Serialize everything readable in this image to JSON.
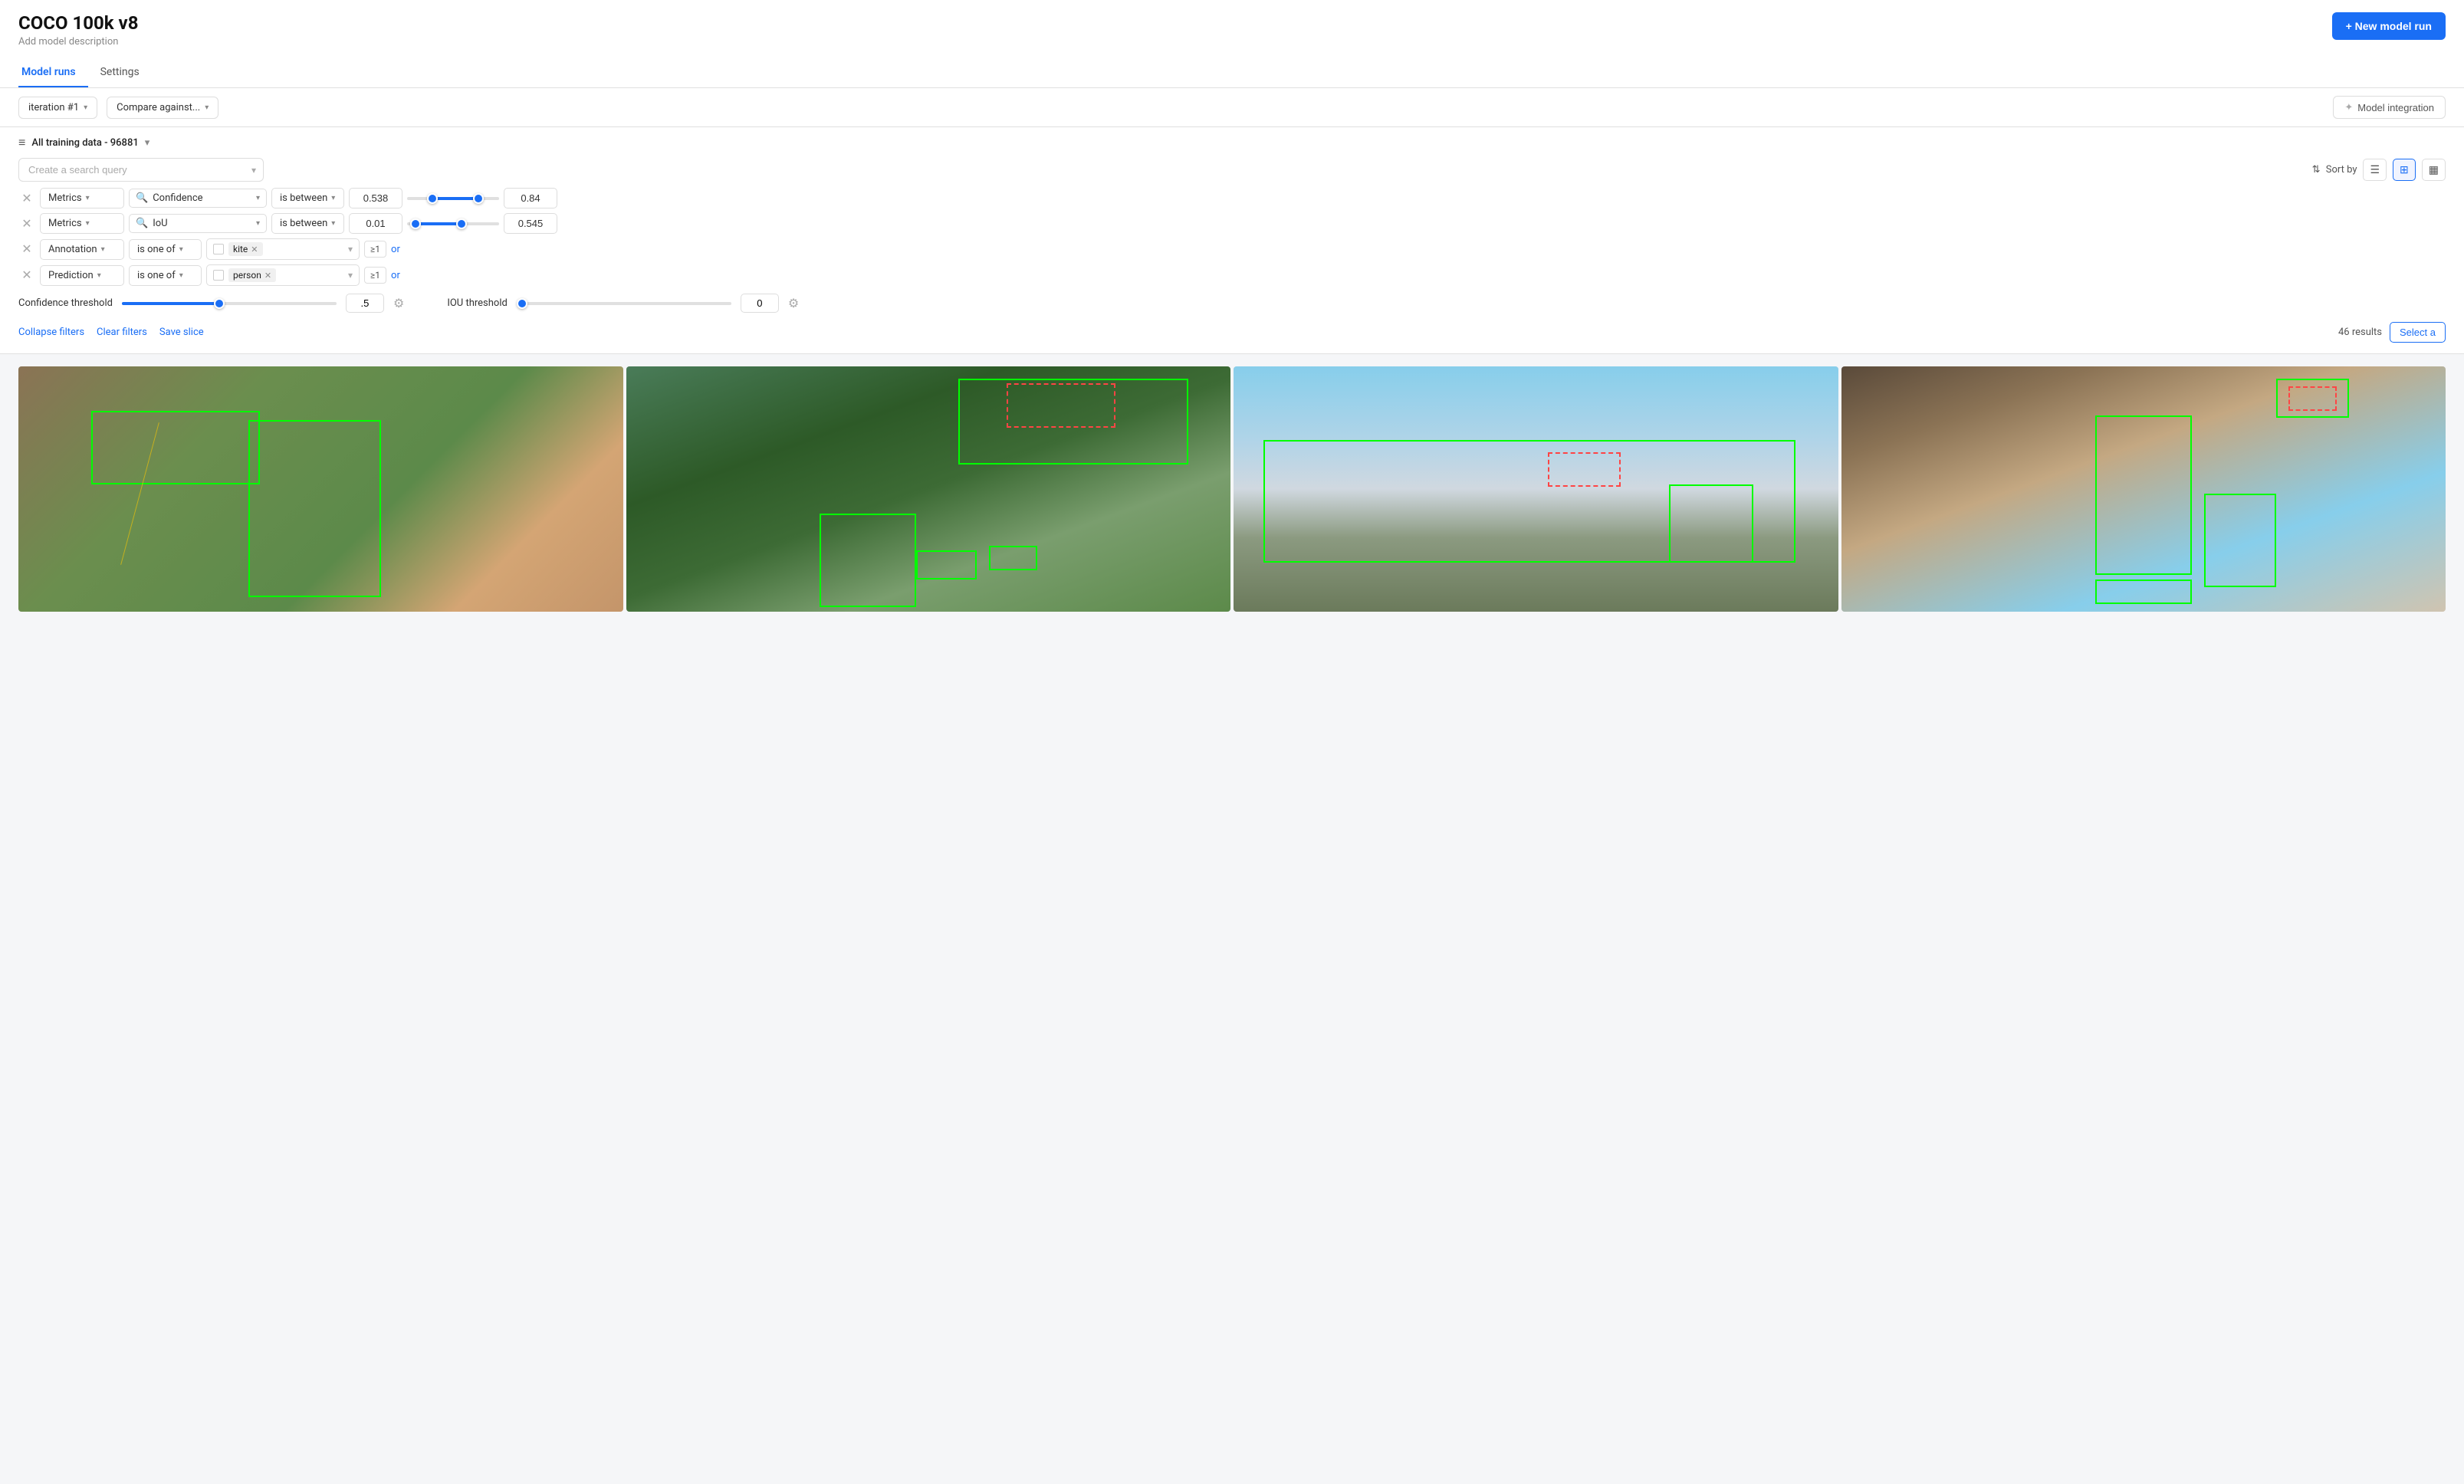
{
  "page": {
    "title": "COCO 100k v8",
    "subtitle": "Add model description",
    "new_model_btn": "+ New model run"
  },
  "tabs": [
    {
      "id": "model-runs",
      "label": "Model runs",
      "active": true
    },
    {
      "id": "settings",
      "label": "Settings",
      "active": false
    }
  ],
  "controls": {
    "iteration": "iteration #1",
    "compare": "Compare against...",
    "model_integration": "Model integration"
  },
  "dataset": {
    "label": "All training data - 96881"
  },
  "search": {
    "placeholder": "Create a search query"
  },
  "sort": {
    "label": "Sort by"
  },
  "filters": [
    {
      "id": "filter-1",
      "category": "Metrics",
      "condition": "is between",
      "search_text": "Confidence",
      "value_low": "0.538",
      "value_high": "0.84",
      "range_low_pct": 25,
      "range_high_pct": 75
    },
    {
      "id": "filter-2",
      "category": "Metrics",
      "condition": "is between",
      "search_text": "IoU",
      "value_low": "0.01",
      "value_high": "0.545",
      "range_low_pct": 5,
      "range_high_pct": 55
    },
    {
      "id": "filter-3",
      "category": "Annotation",
      "condition": "is one of",
      "tag": "kite",
      "ge_label": "≥1",
      "or_label": "or"
    },
    {
      "id": "filter-4",
      "category": "Prediction",
      "condition": "is one of",
      "tag": "person",
      "ge_label": "≥1",
      "or_label": "or"
    }
  ],
  "thresholds": {
    "confidence_label": "Confidence threshold",
    "confidence_value": ".5",
    "confidence_pct": 45,
    "iou_label": "IOU threshold",
    "iou_value": "0",
    "iou_pct": 2
  },
  "bottom": {
    "collapse": "Collapse filters",
    "clear": "Clear filters",
    "save": "Save slice",
    "results_count": "46 results",
    "select_all": "Select a"
  },
  "images": [
    {
      "id": "img-1",
      "css_class": "img-1"
    },
    {
      "id": "img-2",
      "css_class": "img-2"
    },
    {
      "id": "img-3",
      "css_class": "img-3"
    },
    {
      "id": "img-4",
      "css_class": "img-4"
    }
  ]
}
